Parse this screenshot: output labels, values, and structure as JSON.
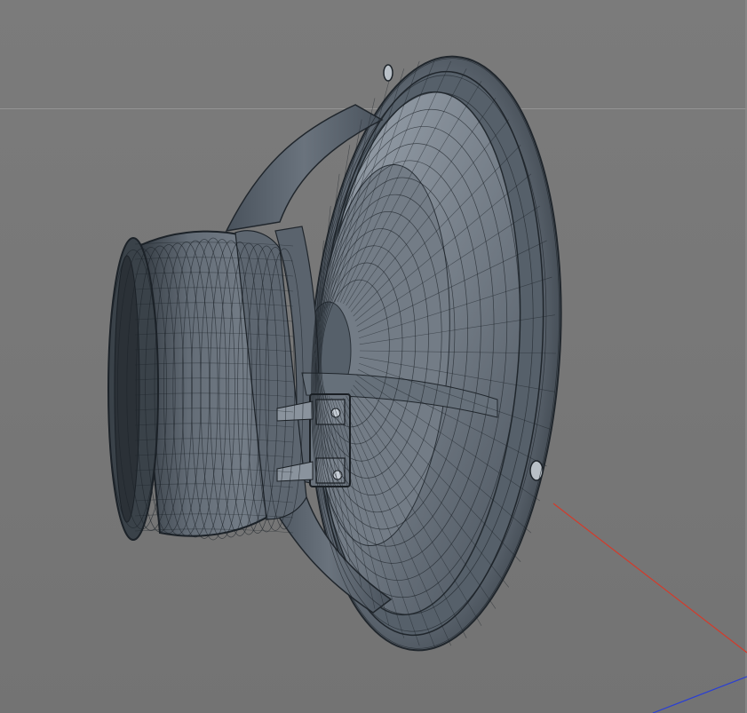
{
  "viewport": {
    "background_color": "#787878",
    "horizon_color": "#9a9a9a"
  },
  "model": {
    "object": "speaker-driver",
    "render_mode": "wireframe-on-shaded",
    "mesh_color": "#5d6670",
    "wire_color": "#1c2228",
    "highlight_color": "#8f98a3"
  },
  "axes": {
    "x_axis_color": "#d43a2a",
    "z_axis_color": "#2a3fd4"
  }
}
